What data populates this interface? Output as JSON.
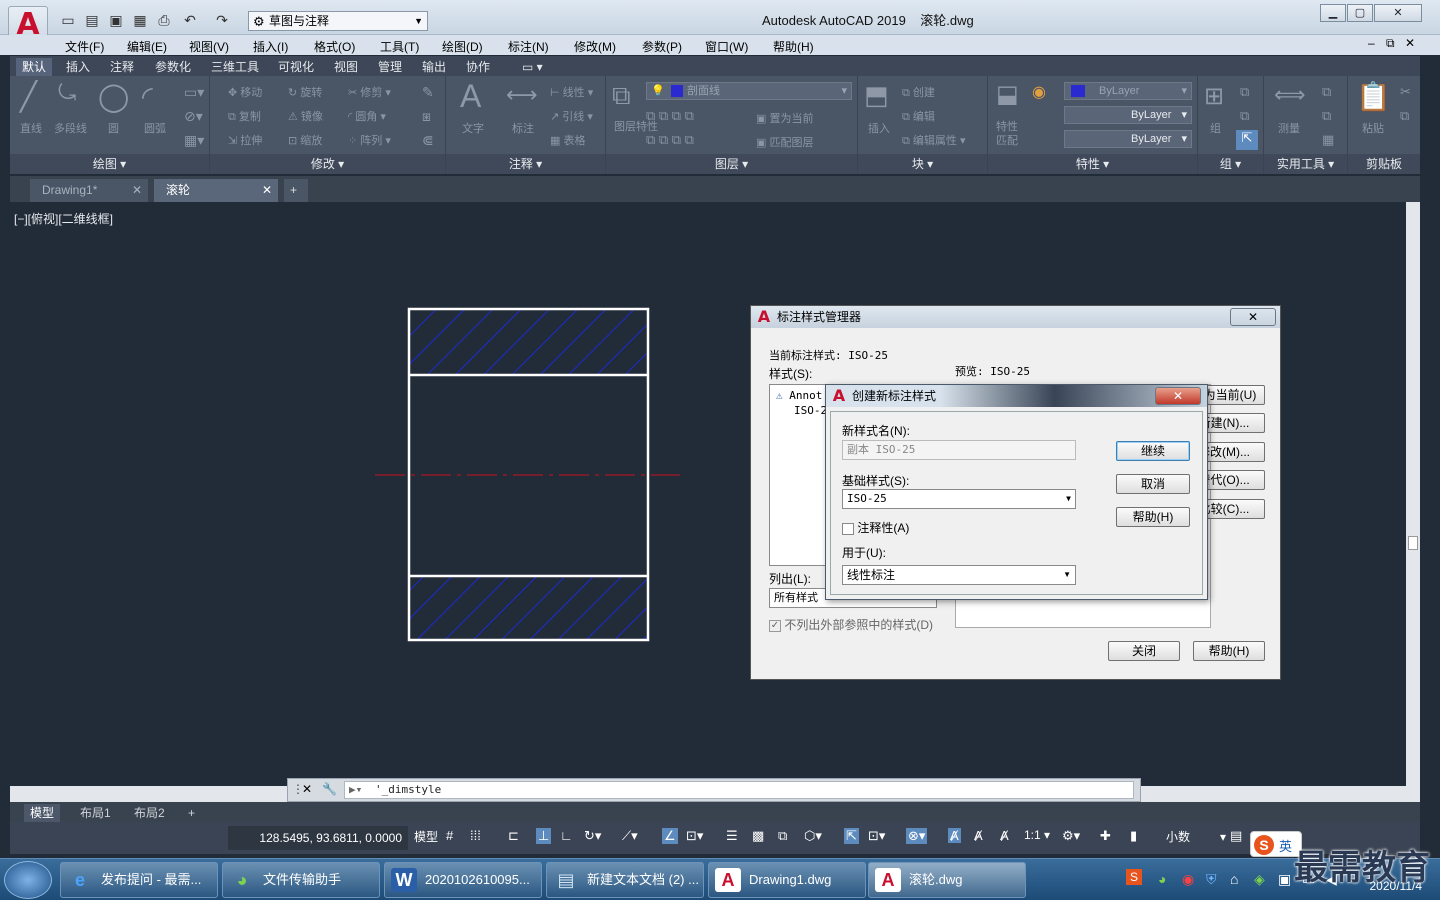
{
  "title_bar": {
    "app_title": "Autodesk AutoCAD 2019",
    "file_name": "滚轮.dwg",
    "workspace": "草图与注释"
  },
  "menu": [
    "文件(F)",
    "编辑(E)",
    "视图(V)",
    "插入(I)",
    "格式(O)",
    "工具(T)",
    "绘图(D)",
    "标注(N)",
    "修改(M)",
    "参数(P)",
    "窗口(W)",
    "帮助(H)"
  ],
  "ribbon_tabs": [
    "默认",
    "插入",
    "注释",
    "参数化",
    "三维工具",
    "可视化",
    "视图",
    "管理",
    "输出",
    "协作"
  ],
  "ribbon": {
    "draw": {
      "title": "绘图",
      "line": "直线",
      "polyline": "多段线",
      "circle": "圆",
      "arc": "圆弧"
    },
    "modify": {
      "title": "修改",
      "move": "移动",
      "rotate": "旋转",
      "trim": "修剪",
      "copy": "复制",
      "mirror": "镜像",
      "fillet": "圆角",
      "stretch": "拉伸",
      "scale": "缩放",
      "array": "阵列"
    },
    "annotation": {
      "title": "注释",
      "text": "文字",
      "dimension": "标注",
      "linear": "线性",
      "leader": "引线",
      "table": "表格"
    },
    "layers": {
      "title": "图层",
      "layer_name": "剖面线",
      "layer_props": "图层特性",
      "set_current": "置为当前",
      "match": "匹配图层"
    },
    "block": {
      "title": "块",
      "insert": "插入",
      "create": "创建",
      "edit": "编辑",
      "edit_attr": "编辑属性"
    },
    "properties": {
      "title": "特性",
      "match": "特性匹配",
      "color": "ByLayer",
      "linetype": "ByLayer",
      "lineweight": "ByLayer"
    },
    "groups": {
      "title": "组",
      "group": "组"
    },
    "utilities": {
      "title": "实用工具",
      "measure": "测量"
    },
    "clipboard": {
      "title": "剪贴板",
      "paste": "粘贴"
    }
  },
  "doc_tabs": [
    "Drawing1*",
    "滚轮"
  ],
  "viewport_label": "[−][俯视][二维线框]",
  "command_line": "'_dimstyle",
  "layout_tabs": [
    "模型",
    "布局1",
    "布局2"
  ],
  "status": {
    "coords": "128.5495, 93.6811, 0.0000",
    "model": "模型",
    "scale": "1:1",
    "units": "小数"
  },
  "dim_manager": {
    "title": "标注样式管理器",
    "current_style": "当前标注样式: ISO-25",
    "styles_label": "样式(S):",
    "styles": [
      "Annot",
      "ISO-2"
    ],
    "preview_label": "预览: ISO-25",
    "list_label": "列出(L):",
    "list_value": "所有样式",
    "xref_checkbox": "不列出外部参照中的样式(D)",
    "buttons": [
      "置为当前(U)",
      "新建(N)...",
      "修改(M)...",
      "替代(O)...",
      "比较(C)..."
    ],
    "close": "关闭",
    "help": "帮助(H)"
  },
  "new_style": {
    "title": "创建新标注样式",
    "name_label": "新样式名(N):",
    "name_value": "副本 ISO-25",
    "base_label": "基础样式(S):",
    "base_value": "ISO-25",
    "annotative": "注释性(A)",
    "use_for_label": "用于(U):",
    "use_for_value": "线性标注",
    "continue": "继续",
    "cancel": "取消",
    "help": "帮助(H)"
  },
  "taskbar": {
    "tasks": [
      "发布提问 - 最需...",
      "文件传输助手",
      "2020102610095...",
      "新建文本文档 (2) ...",
      "Drawing1.dwg",
      "滚轮.dwg"
    ],
    "date": "2020/11/4",
    "ime": "英"
  },
  "watermark": "最需教育",
  "colors": {
    "canvas": "#222b38",
    "hatch": "#1a2cff",
    "centerline": "#cc1122",
    "accent": "#c8102e"
  }
}
